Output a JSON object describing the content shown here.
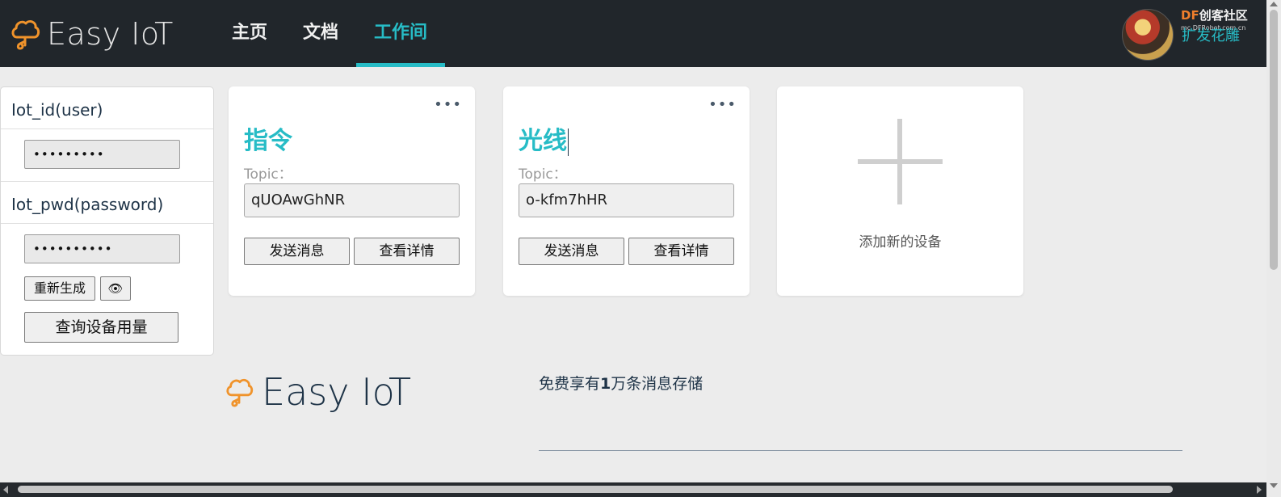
{
  "header": {
    "logo_text": "Easy IoT",
    "nav": [
      {
        "label": "主页"
      },
      {
        "label": "文档"
      },
      {
        "label": "工作间"
      }
    ],
    "brand": {
      "prefix": "DF",
      "suffix": "创客社区",
      "url": "mc.DFRobot.com.cn"
    },
    "user_name": "扩发花雕"
  },
  "credentials": {
    "id_label": "Iot_id(user)",
    "id_value": "•••••••••",
    "pwd_label": "Iot_pwd(password)",
    "pwd_value": "••••••••••",
    "regenerate_label": "重新生成",
    "show_icon": "👁",
    "query_usage_label": "查询设备用量"
  },
  "devices": [
    {
      "name": "指令",
      "topic_label": "Topic：",
      "topic": "qUOAwGhNR",
      "send_label": "发送消息",
      "details_label": "查看详情",
      "menu": "•••"
    },
    {
      "name": "光线",
      "topic_label": "Topic：",
      "topic": "o-kfm7hHR",
      "send_label": "发送消息",
      "details_label": "查看详情",
      "menu": "•••"
    }
  ],
  "add_device": {
    "label": "添加新的设备"
  },
  "footer": {
    "logo_text": "Easy IoT",
    "promo_prefix": "免费享有",
    "promo_number": "1",
    "promo_suffix": "万条消息存储"
  },
  "colors": {
    "accent": "#27bcc6",
    "header_bg": "#21262b",
    "logo_orange": "#f0932b"
  }
}
